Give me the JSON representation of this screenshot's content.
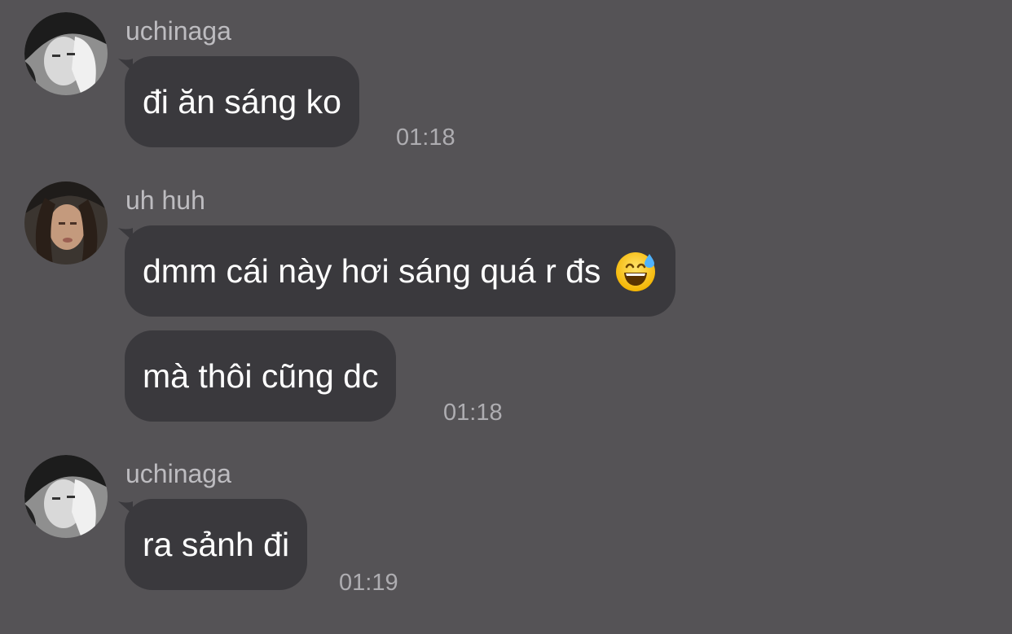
{
  "colors": {
    "background": "#555356",
    "bubble": "#3a393d",
    "message_text": "#ffffff",
    "sender_text": "#bdbcc0",
    "time_text": "#aeadb1"
  },
  "messages": [
    {
      "sender": "uchinaga",
      "avatar": "user-avatar-uchinaga",
      "bubbles": [
        {
          "text": "đi ăn sáng ko"
        }
      ],
      "time": "01:18"
    },
    {
      "sender": "uh huh",
      "avatar": "user-avatar-uh-huh",
      "bubbles": [
        {
          "text": "dmm cái này hơi sáng quá r đs",
          "emoji": "grinning-face-with-sweat-icon"
        },
        {
          "text": "mà thôi cũng dc"
        }
      ],
      "time": "01:18"
    },
    {
      "sender": "uchinaga",
      "avatar": "user-avatar-uchinaga",
      "bubbles": [
        {
          "text": "ra sảnh đi"
        }
      ],
      "time": "01:19"
    }
  ]
}
